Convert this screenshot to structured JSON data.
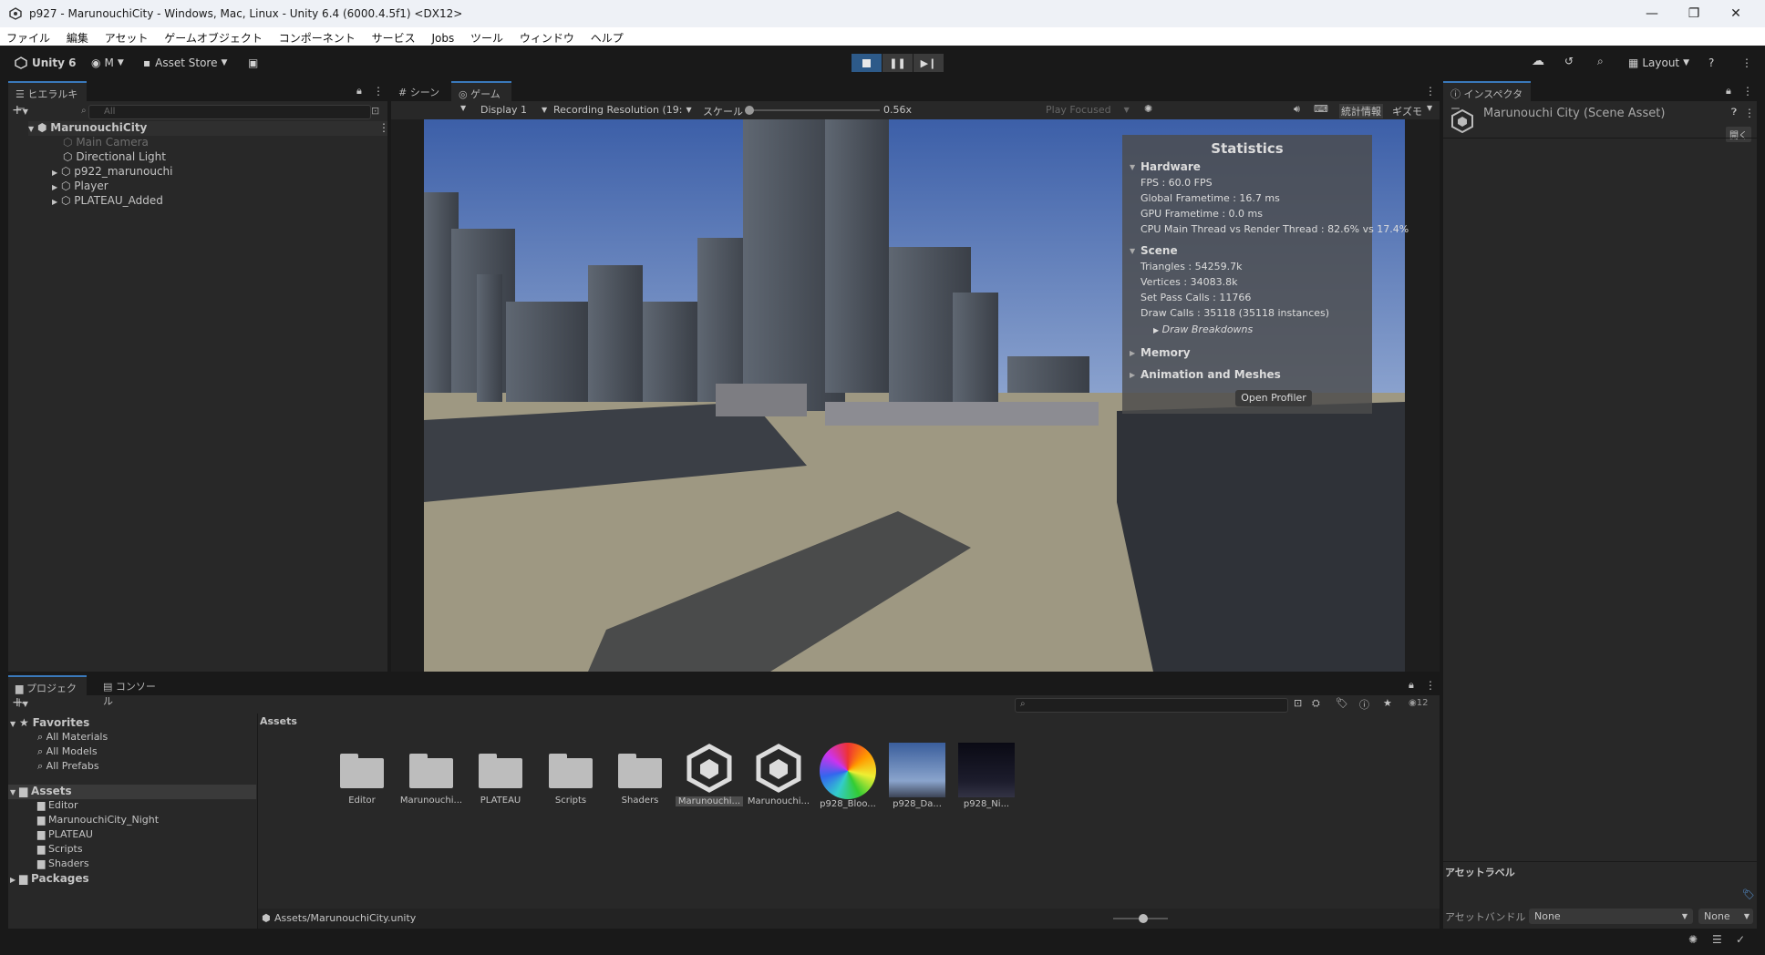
{
  "window": {
    "title": "p927 - MarunouchiCity - Windows, Mac, Linux - Unity 6.4 (6000.4.5f1) <DX12>",
    "minimize": "—",
    "maximize": "❐",
    "close": "✕"
  },
  "menu": [
    "ファイル",
    "編集",
    "アセット",
    "ゲームオブジェクト",
    "コンポーネント",
    "サービス",
    "Jobs",
    "ツール",
    "ウィンドウ",
    "ヘルプ"
  ],
  "toolbar": {
    "unity": "Unity 6",
    "account": "M",
    "asset_store": "Asset Store",
    "layout": "Layout"
  },
  "hierarchy": {
    "tab": "ヒエラルキー",
    "search_placeholder": "All",
    "scene": "MarunouchiCity",
    "items": [
      {
        "label": "Main Camera"
      },
      {
        "label": "Directional Light"
      },
      {
        "label": "p922_marunouchi"
      },
      {
        "label": "Player"
      },
      {
        "label": "PLATEAU_Added"
      }
    ]
  },
  "game": {
    "tabs": [
      "シーン",
      "ゲーム"
    ],
    "display": "Display 1",
    "resolution": "Recording Resolution (19:",
    "scale_label": "スケール",
    "scale_value": "0.56x",
    "scale_fraction": 0.0,
    "play_focused": "Play Focused",
    "stats_btn": "統計情報",
    "gizmo_btn": "ギズモ"
  },
  "stats": {
    "title": "Statistics",
    "hardware": "Hardware",
    "fps": "FPS : 60.0 FPS",
    "global_frametime": "Global Frametime : 16.7 ms",
    "gpu_frametime": "GPU Frametime : 0.0 ms",
    "cpu": "CPU Main Thread vs Render Thread : 82.6% vs 17.4%",
    "scene": "Scene",
    "triangles": "Triangles : 54259.7k",
    "vertices": "Vertices : 34083.8k",
    "setpass": "Set Pass Calls : 11766",
    "drawcalls": "Draw Calls : 35118 (35118 instances)",
    "draw_breakdowns": "Draw Breakdowns",
    "memory": "Memory",
    "animation": "Animation and Meshes",
    "open_profiler": "Open Profiler"
  },
  "inspector": {
    "tab": "インスペクター",
    "title": "Marunouchi City (Scene Asset)",
    "open_btn": "開く",
    "asset_labels": "アセットラベル",
    "asset_bundle": "アセットバンドル",
    "bundle_value": "None",
    "variant_value": "None"
  },
  "project": {
    "tabs": [
      "プロジェクト",
      "コンソール"
    ],
    "favorites": "Favorites",
    "fav_items": [
      "All Materials",
      "All Models",
      "All Prefabs"
    ],
    "assets": "Assets",
    "asset_folders": [
      "Editor",
      "MarunouchiCity_Night",
      "PLATEAU",
      "Scripts",
      "Shaders"
    ],
    "packages": "Packages",
    "breadcrumb": "Assets",
    "grid": [
      {
        "label": "Editor",
        "kind": "folder"
      },
      {
        "label": "Marunouchi...",
        "kind": "folder"
      },
      {
        "label": "PLATEAU",
        "kind": "folder"
      },
      {
        "label": "Scripts",
        "kind": "folder"
      },
      {
        "label": "Shaders",
        "kind": "folder"
      },
      {
        "label": "Marunouchi...",
        "kind": "unity",
        "selected": true
      },
      {
        "label": "Marunouchi...",
        "kind": "unity"
      },
      {
        "label": "p928_Bloo...",
        "kind": "wheel"
      },
      {
        "label": "p928_Da...",
        "kind": "sky-day"
      },
      {
        "label": "p928_Ni...",
        "kind": "sky-night"
      }
    ],
    "count": "12",
    "path": "Assets/MarunouchiCity.unity"
  }
}
